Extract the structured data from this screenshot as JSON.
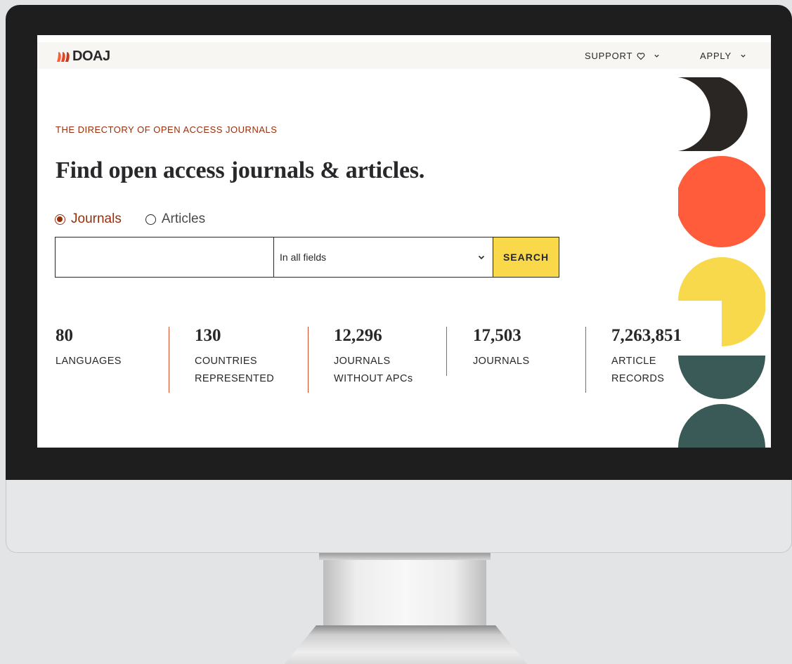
{
  "brand": {
    "name": "DOAJ"
  },
  "nav": {
    "support_label": "SUPPORT",
    "apply_label": "APPLY"
  },
  "hero": {
    "eyebrow": "THE DIRECTORY OF OPEN ACCESS JOURNALS",
    "headline": "Find open access journals & articles."
  },
  "search": {
    "radio_options": [
      {
        "label": "Journals",
        "selected": true
      },
      {
        "label": "Articles",
        "selected": false
      }
    ],
    "input_value": "",
    "field_select_value": "In all fields",
    "button_label": "SEARCH"
  },
  "stats": [
    {
      "number": "80",
      "label": "LANGUAGES"
    },
    {
      "number": "130",
      "label": "COUNTRIES\nREPRESENTED"
    },
    {
      "number": "12,296",
      "label": "JOURNALS\nWITHOUT APCs"
    },
    {
      "number": "17,503",
      "label": "JOURNALS"
    },
    {
      "number": "7,263,851",
      "label": "ARTICLE\nRECORDS"
    }
  ],
  "colors": {
    "accent_red": "#982e0a",
    "divider_red": "#d64d2a",
    "search_yellow": "#f9d94a",
    "shape_black": "#2a2623",
    "shape_orange": "#fe5c3b",
    "shape_yellow": "#f8d94c",
    "shape_teal": "#3a5a58"
  },
  "icons": {
    "logo": "doaj-logo-mark",
    "support": "heart-icon",
    "dropdown": "chevron-down-icon",
    "select": "chevron-down-icon"
  }
}
